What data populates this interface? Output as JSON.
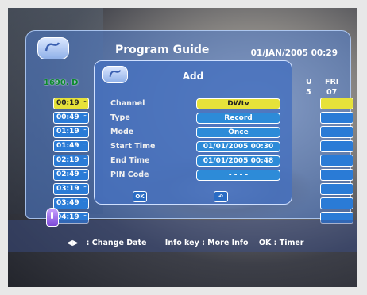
{
  "guide": {
    "title": "Program Guide",
    "datetime": "01/JAN/2005 00:29",
    "channel_id": "1690. D",
    "day_short": "U",
    "day_num": "5",
    "day_name": "FRI",
    "day_date": "07",
    "time_slots": [
      "00:19",
      "00:49",
      "01:19",
      "01:49",
      "02:19",
      "02:49",
      "03:19",
      "03:49",
      "04:19"
    ]
  },
  "dialog": {
    "title": "Add",
    "fields": [
      {
        "label": "Channel",
        "value": "DWtv"
      },
      {
        "label": "Type",
        "value": "Record"
      },
      {
        "label": "Mode",
        "value": "Once"
      },
      {
        "label": "Start Time",
        "value": "01/01/2005 00:30"
      },
      {
        "label": "End Time",
        "value": "01/01/2005 00:48"
      },
      {
        "label": "PIN Code",
        "value": "- - - -"
      }
    ],
    "ok_label": "OK",
    "back_label": "↶"
  },
  "help": {
    "change_date": ": Change Date",
    "info": "Info key : More Info",
    "ok": "OK : Timer"
  },
  "colors": {
    "accent": "#e6e23a",
    "panel": "#4e7ed2",
    "field": "#2d8bd8"
  }
}
